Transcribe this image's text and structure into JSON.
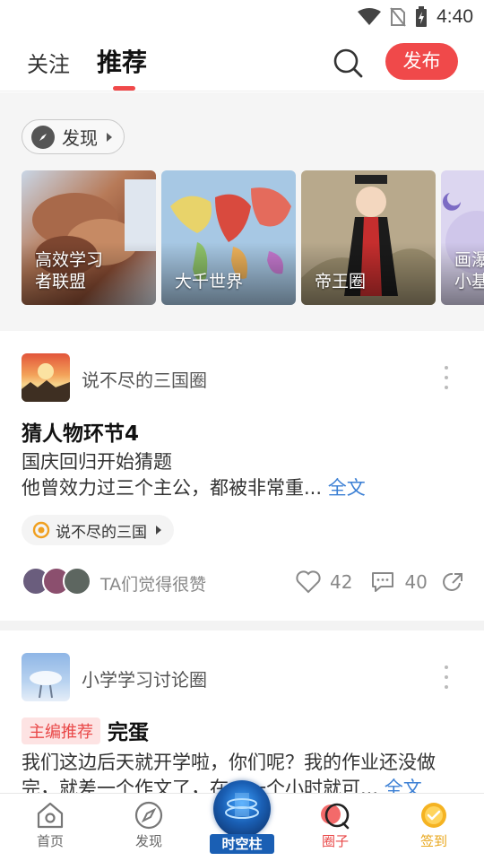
{
  "status_bar": {
    "time": "4:40",
    "icons": [
      "wifi-icon",
      "no-sim-icon",
      "battery-charging-icon"
    ]
  },
  "header": {
    "tabs": [
      {
        "label": "关注",
        "active": false
      },
      {
        "label": "推荐",
        "active": true
      }
    ],
    "search_icon": "search-icon",
    "publish_label": "发布",
    "accent_color": "#f0494a"
  },
  "discover": {
    "chip_label": "发现",
    "cards": [
      {
        "label_line1": "高效学习",
        "label_line2": "者联盟"
      },
      {
        "label_line1": "大千世界",
        "label_line2": ""
      },
      {
        "label_line1": "帝王圈",
        "label_line2": ""
      },
      {
        "label_line1": "画瀑",
        "label_line2": "小基"
      }
    ]
  },
  "posts": [
    {
      "circle": "说不尽的三国圈",
      "title": "猜人物环节4",
      "body_line1": "国庆回归开始猜题",
      "body_line2": "他曾效力过三个主公，都被非常重...",
      "full_text_link": "全文",
      "tag": "说不尽的三国",
      "likers_text": "TA们觉得很赞",
      "likes": "42",
      "comments": "40"
    },
    {
      "circle": "小学学习讨论圈",
      "badge": "主编推荐",
      "title": "完蛋",
      "body_line1": "我们这边后天就开学啦，你们呢？我的作业还没做",
      "body_line2": "完，就差一个作文了，在…一个小时就可...",
      "full_text_link": "全文"
    }
  ],
  "bottom_nav": [
    {
      "label": "首页",
      "icon": "home-icon"
    },
    {
      "label": "发现",
      "icon": "compass-icon"
    },
    {
      "label": "时空柱",
      "icon": "portal-orb-icon"
    },
    {
      "label": "圈子",
      "icon": "circle-chat-icon",
      "active": true
    },
    {
      "label": "签到",
      "icon": "checkin-icon"
    }
  ]
}
